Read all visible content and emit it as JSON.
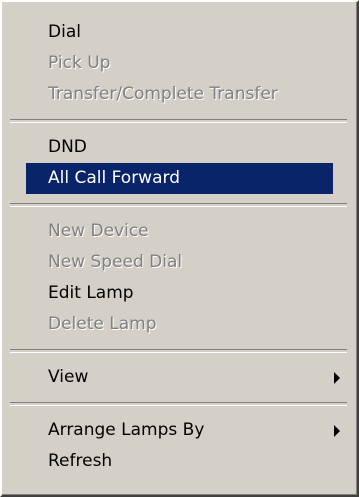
{
  "menu": {
    "items": [
      {
        "label": "Dial"
      },
      {
        "label": "Pick Up"
      },
      {
        "label": "Transfer/Complete Transfer"
      },
      {
        "label": "DND"
      },
      {
        "label": "All Call Forward"
      },
      {
        "label": "New Device"
      },
      {
        "label": "New Speed Dial"
      },
      {
        "label": "Edit Lamp"
      },
      {
        "label": "Delete Lamp"
      },
      {
        "label": "View"
      },
      {
        "label": "Arrange Lamps By"
      },
      {
        "label": "Refresh"
      }
    ]
  },
  "icons": {
    "submenu_arrow": "triangle-right-icon"
  },
  "colors": {
    "menu_background": "#d4d0c8",
    "selection_background": "#0a246a",
    "disabled_text": "#808080"
  }
}
